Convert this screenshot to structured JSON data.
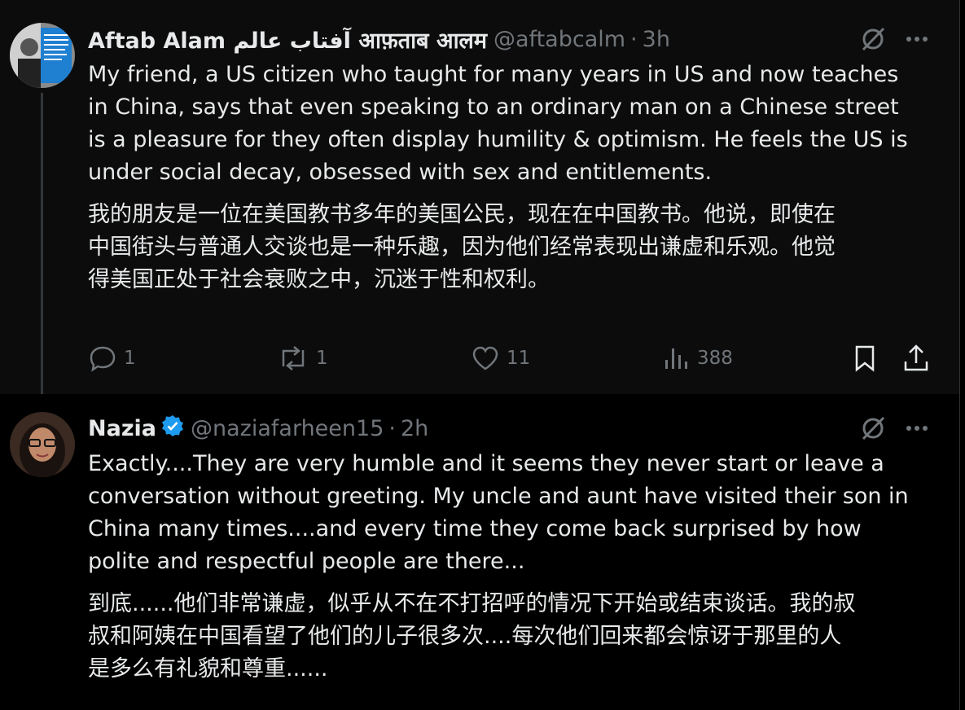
{
  "tweets": [
    {
      "author_name": "Aftab Alam آفتاب عالم आफ़ताब आलम",
      "handle": "@aftabcalm",
      "separator": "·",
      "time": "3h",
      "text_en": "My friend, a US citizen who taught for many years in US and now teaches\nin China, says that even speaking to an ordinary man on a Chinese street\nis a pleasure for they often display humility & optimism. He feels the US is\nunder social decay, obsessed with sex and entitlements.",
      "text_zh": "我的朋友是一位在美国教书多年的美国公民，现在在中国教书。他说，即使在\n中国街头与普通人交谈也是一种乐趣，因为他们经常表现出谦虚和乐观。他觉\n得美国正处于社会衰败之中，沉迷于性和权利。",
      "replies": "1",
      "reposts": "1",
      "likes": "11",
      "views": "388"
    },
    {
      "author_name": "Nazia",
      "handle": "@naziafarheen15",
      "separator": "·",
      "time": "2h",
      "verified": true,
      "text_en": "Exactly....They are very humble and it seems they never start or leave a\nconversation without greeting. My uncle and aunt have visited their son in\nChina many times....and every time they come back surprised by how\npolite and respectful people are there...",
      "text_zh": "到底......他们非常谦虚，似乎从不在不打招呼的情况下开始或结束谈话。我的叔\n叔和阿姨在中国看望了他们的儿子很多次....每次他们回来都会惊讶于那里的人\n是多么有礼貌和尊重......"
    }
  ],
  "colors": {
    "background": "#000000",
    "text": "#e7e9ea",
    "muted": "#71767b",
    "verified": "#1d9bf0"
  },
  "icons": [
    "grok-icon",
    "more-icon",
    "reply-icon",
    "repost-icon",
    "like-icon",
    "views-icon",
    "bookmark-icon",
    "share-icon",
    "verified-badge-icon"
  ]
}
